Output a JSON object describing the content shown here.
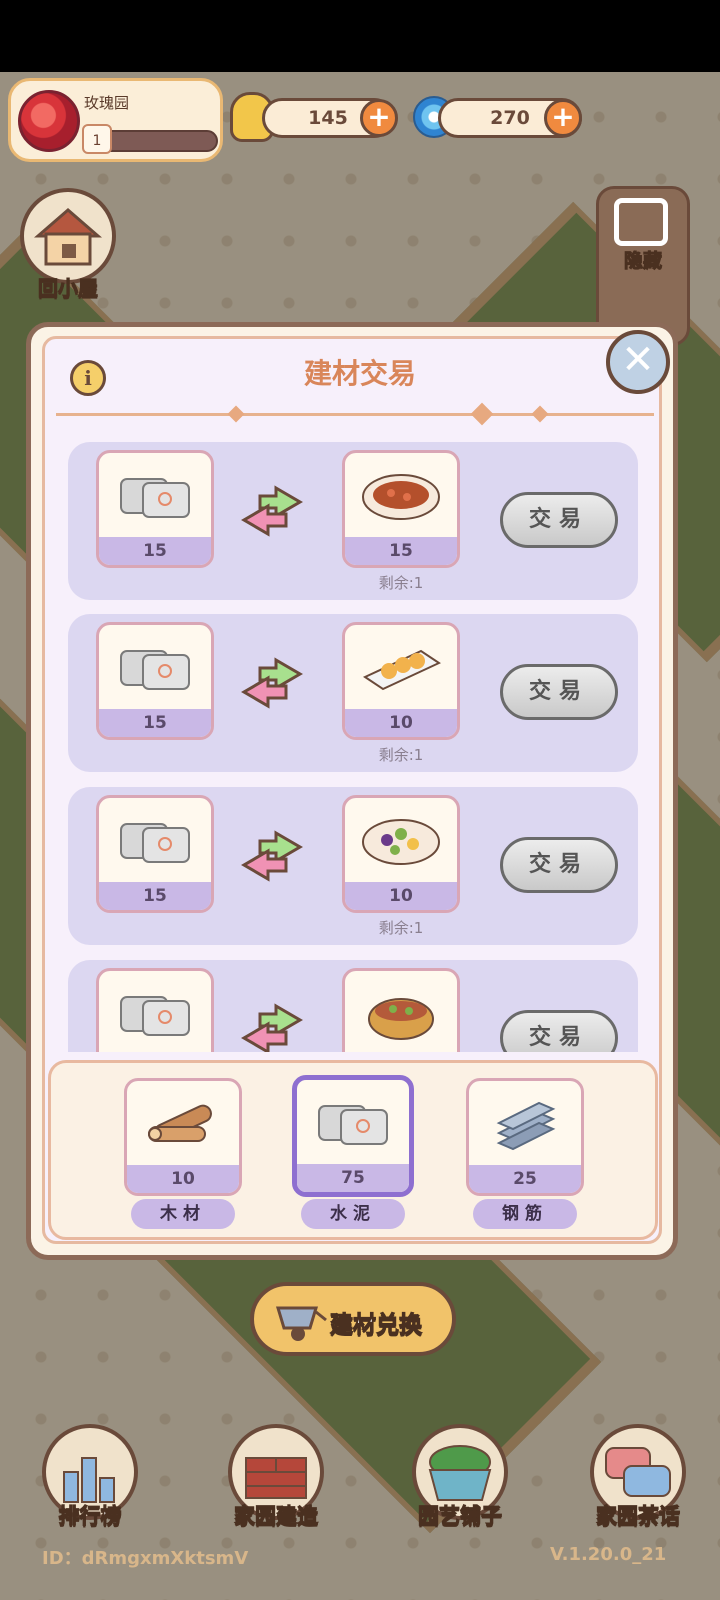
{
  "hud": {
    "garden_name": "玫瑰园",
    "level": "1",
    "coins": "145",
    "gems": "270"
  },
  "side": {
    "home_label": "回小屋",
    "hide_label": "隐藏"
  },
  "modal": {
    "title": "建材交易",
    "info_symbol": "i",
    "close_symbol": "✕",
    "trades": [
      {
        "give_qty": "15",
        "get_qty": "15",
        "button": "交易",
        "remaining": "剩余:1",
        "dish": "meat-dish"
      },
      {
        "give_qty": "15",
        "get_qty": "10",
        "button": "交易",
        "remaining": "剩余:1",
        "dish": "fried-snack-dish"
      },
      {
        "give_qty": "15",
        "get_qty": "10",
        "button": "交易",
        "remaining": "剩余:1",
        "dish": "vegetable-dish"
      },
      {
        "give_qty": "",
        "get_qty": "",
        "button": "交易",
        "remaining": "",
        "dish": "stew-pot"
      }
    ],
    "materials": [
      {
        "label": "木材",
        "qty": "10",
        "icon": "wood-icon",
        "selected": false
      },
      {
        "label": "水泥",
        "qty": "75",
        "icon": "cement-bag-icon",
        "selected": true
      },
      {
        "label": "钢筋",
        "qty": "25",
        "icon": "steel-bar-icon",
        "selected": false
      }
    ]
  },
  "exchange_button": "建材兑换",
  "bottom_nav": [
    {
      "label": "排行榜",
      "icon": "leaderboard-icon"
    },
    {
      "label": "家园建造",
      "icon": "brick-build-icon"
    },
    {
      "label": "园艺铺子",
      "icon": "flower-pot-icon"
    },
    {
      "label": "家园茶话",
      "icon": "chat-bubbles-icon"
    }
  ],
  "footer": {
    "id_text": "ID：dRmgxmXktsmV",
    "version": "V.1.20.0_21"
  },
  "colors": {
    "accent_orange": "#f08a3f",
    "modal_title": "#d9865a",
    "row_bg": "#dcd7f1",
    "selected_border": "#8e6fd0"
  }
}
